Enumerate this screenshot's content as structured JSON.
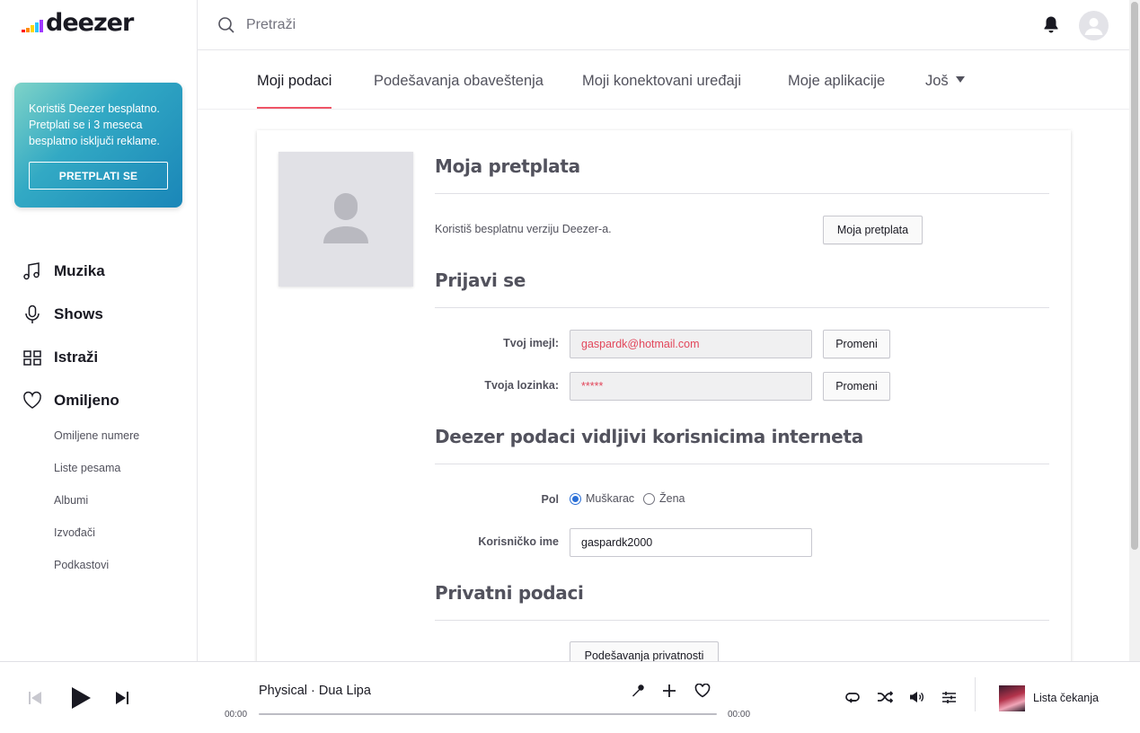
{
  "brand": {
    "name": "deezer",
    "bar_colors": [
      "#ff0000",
      "#ff8a00",
      "#ffd600",
      "#2ec6ff",
      "#a238ff"
    ]
  },
  "promo": {
    "text": "Koristiš Deezer besplatno. Pretplati se i 3 meseca besplatno isključi reklame.",
    "button": "PRETPLATI SE"
  },
  "sidebar": {
    "items": [
      {
        "label": "Muzika",
        "icon": "music-note-icon"
      },
      {
        "label": "Shows",
        "icon": "microphone-icon"
      },
      {
        "label": "Istraži",
        "icon": "explore-grid-icon"
      },
      {
        "label": "Omiljeno",
        "icon": "heart-icon"
      }
    ],
    "favorites": [
      "Omiljene numere",
      "Liste pesama",
      "Albumi",
      "Izvođači",
      "Podkastovi"
    ]
  },
  "search": {
    "placeholder": "Pretraži"
  },
  "tabs": [
    {
      "label": "Moji podaci",
      "active": true
    },
    {
      "label": "Podešavanja obaveštenja"
    },
    {
      "label": "Moji konektovani uređaji"
    },
    {
      "label": "Moje aplikacije"
    },
    {
      "label": "Još"
    }
  ],
  "subscription": {
    "title": "Moja pretplata",
    "text": "Koristiš besplatnu verziju Deezer-a.",
    "button": "Moja pretplata"
  },
  "login": {
    "title": "Prijavi se",
    "email_label": "Tvoj imejl:",
    "email_value": "gaspardk@hotmail.com",
    "password_label": "Tvoja lozinka:",
    "password_value": "*****",
    "change_button": "Promeni"
  },
  "public_data": {
    "title": "Deezer podaci vidljivi korisnicima interneta",
    "gender_label": "Pol",
    "gender_options": [
      "Muškarac",
      "Žena"
    ],
    "gender_selected": "Muškarac",
    "username_label": "Korisničko ime",
    "username_value": "gaspardk2000"
  },
  "private_data": {
    "title": "Privatni podaci",
    "button": "Podešavanja privatnosti"
  },
  "player": {
    "track": "Physical · Dua Lipa",
    "time_elapsed": "00:00",
    "time_total": "00:00",
    "progress": 0,
    "queue_label": "Lista čekanja"
  },
  "colors": {
    "accent": "#ef5466",
    "radio_selected": "#2b6fd6"
  }
}
